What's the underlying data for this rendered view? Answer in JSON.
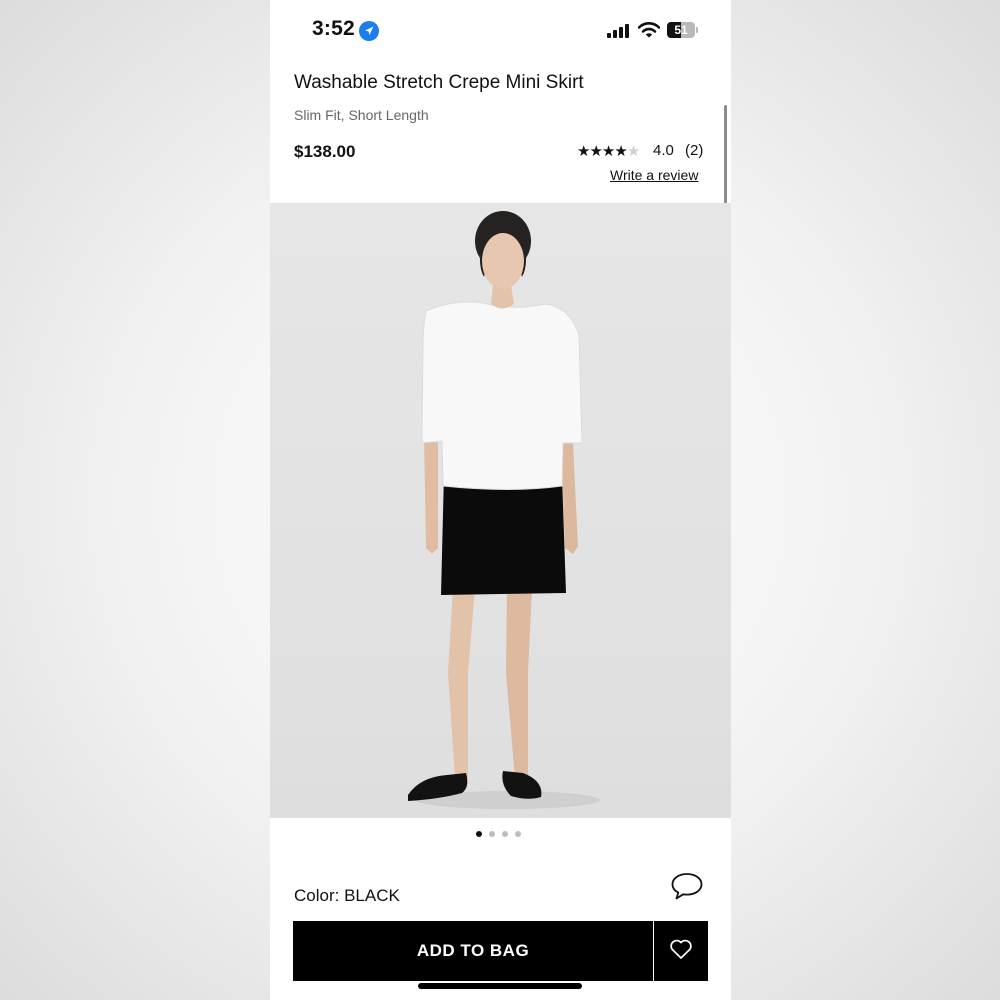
{
  "status_bar": {
    "time": "3:52",
    "battery": "51",
    "battery_level": 0.51
  },
  "product": {
    "title": "Washable Stretch Crepe Mini Skirt",
    "subtitle": "Slim Fit, Short Length",
    "price": "$138.00",
    "rating_stars": 4,
    "rating": "4.0",
    "review_count": "(2)",
    "write_review": "Write a review"
  },
  "gallery": {
    "image_count": 4,
    "active_index": 0
  },
  "color": {
    "label": "Color: BLACK"
  },
  "actions": {
    "add_to_bag": "ADD TO BAG"
  },
  "icons": [
    "location-icon",
    "signal-icon",
    "wifi-icon",
    "battery-icon",
    "star-icon",
    "chat-icon",
    "heart-icon"
  ],
  "colors": {
    "accent": "#1a7df2",
    "primary_button": "#000000"
  }
}
